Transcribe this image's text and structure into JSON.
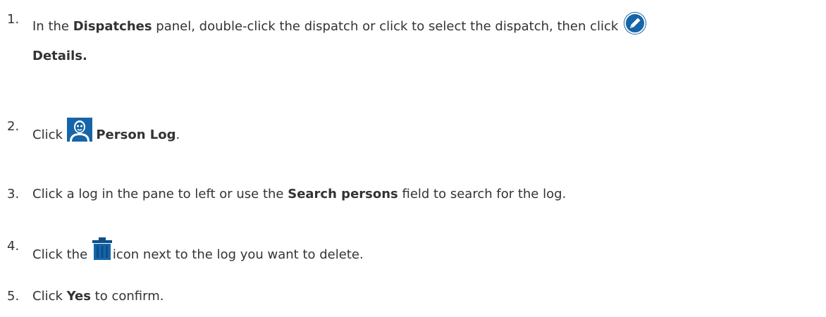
{
  "steps": [
    {
      "number": "1.",
      "pre": "In the ",
      "bold": "Dispatches",
      "post": " panel, double-click the dispatch or click to select the dispatch, then click",
      "icon": "edit-pencil-icon",
      "line2_bold": "Details."
    },
    {
      "number": "2.",
      "pre": "Click ",
      "icon": "person-log-icon",
      "bold": "Person Log",
      "post": "."
    },
    {
      "number": "3.",
      "pre": "Click a log in the pane to left or use the ",
      "bold": "Search persons",
      "post": " field to search for the log."
    },
    {
      "number": "4.",
      "pre": "Click the ",
      "icon": "trash-icon",
      "post": "icon next to the log you want to delete."
    },
    {
      "number": "5.",
      "pre": "Click ",
      "bold": "Yes",
      "post": " to confirm."
    }
  ],
  "colors": {
    "text": "#333333",
    "icon_blue": "#1565a8",
    "icon_dark_blue": "#0d4d8a"
  }
}
